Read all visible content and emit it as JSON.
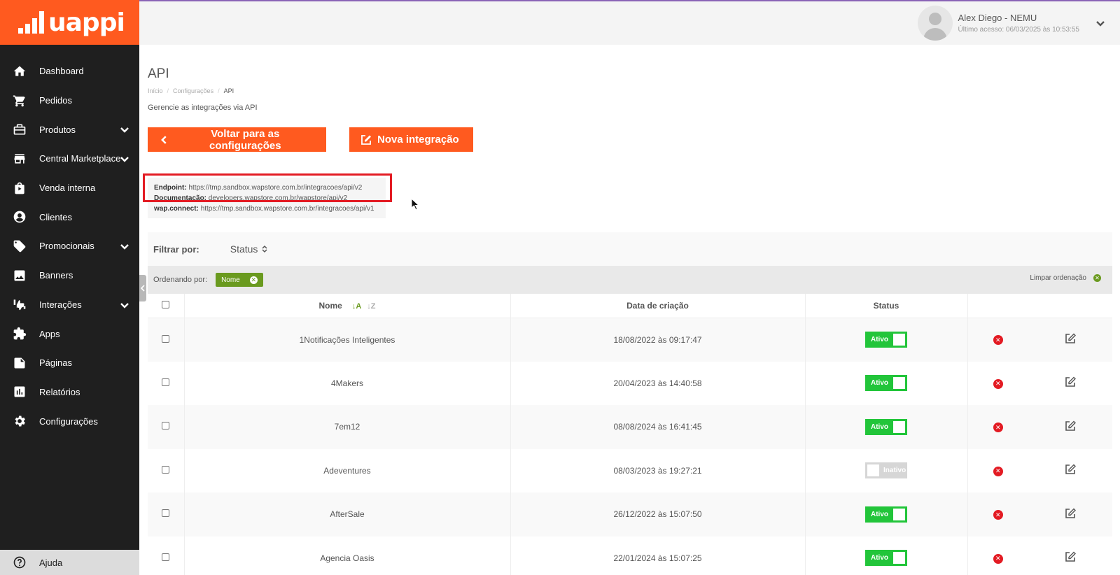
{
  "brand": {
    "name": "uappi"
  },
  "sidebar": {
    "items": [
      {
        "label": "Dashboard",
        "icon": "home-icon"
      },
      {
        "label": "Pedidos",
        "icon": "cart-icon"
      },
      {
        "label": "Produtos",
        "icon": "box-icon",
        "expandable": true
      },
      {
        "label": "Central Marketplace",
        "icon": "store-icon",
        "expandable": true
      },
      {
        "label": "Venda interna",
        "icon": "bag-icon"
      },
      {
        "label": "Clientes",
        "icon": "user-icon"
      },
      {
        "label": "Promocionais",
        "icon": "tag-icon",
        "expandable": true
      },
      {
        "label": "Banners",
        "icon": "image-icon"
      },
      {
        "label": "Interações",
        "icon": "thumbs-icon",
        "expandable": true
      },
      {
        "label": "Apps",
        "icon": "puzzle-icon"
      },
      {
        "label": "Páginas",
        "icon": "page-icon"
      },
      {
        "label": "Relatórios",
        "icon": "chart-icon"
      },
      {
        "label": "Configurações",
        "icon": "gear-icon"
      }
    ],
    "help_label": "Ajuda"
  },
  "header": {
    "user_name": "Alex Diego - NEMU",
    "last_access": "Último acesso: 06/03/2025 às 10:53:55"
  },
  "page": {
    "title": "API",
    "breadcrumb": [
      "Início",
      "Configurações",
      "API"
    ],
    "subtitle": "Gerencie as integrações via API"
  },
  "buttons": {
    "back": "Voltar para as configurações",
    "new": "Nova integração"
  },
  "api_info": {
    "endpoint_label": "Endpoint:",
    "endpoint_value": "https://tmp.sandbox.wapstore.com.br/integracoes/api/v2",
    "docs_label": "Documentação:",
    "docs_value": "developers.wapstore.com.br/wapstore/api/v2",
    "wapconnect_label": "wap.connect:",
    "wapconnect_value": "https://tmp.sandbox.wapstore.com.br/integracoes/api/v1"
  },
  "filter": {
    "label": "Filtrar por:",
    "status": "Status"
  },
  "ordering": {
    "label": "Ordenando por:",
    "chip": "Nome",
    "clear": "Limpar ordenação"
  },
  "table": {
    "headers": {
      "name": "Nome",
      "sort_a": "↓A",
      "sort_z": "↓Z",
      "created": "Data de criação",
      "status": "Status"
    },
    "rows": [
      {
        "name": "1Notificações Inteligentes",
        "created": "18/08/2022 às 09:17:47",
        "status": "Ativo",
        "active": true
      },
      {
        "name": "4Makers",
        "created": "20/04/2023 às 14:40:58",
        "status": "Ativo",
        "active": true
      },
      {
        "name": "7em12",
        "created": "08/08/2024 às 16:41:45",
        "status": "Ativo",
        "active": true
      },
      {
        "name": "Adeventures",
        "created": "08/03/2023 às 19:27:21",
        "status": "Inativo",
        "active": false
      },
      {
        "name": "AfterSale",
        "created": "26/12/2022 às 15:07:50",
        "status": "Ativo",
        "active": true
      },
      {
        "name": "Agencia Oasis",
        "created": "22/01/2024 às 15:07:25",
        "status": "Ativo",
        "active": true
      }
    ]
  },
  "colors": {
    "brand": "#ff5a1f",
    "sidebar": "#1f1f1f",
    "active": "#22c53a",
    "inactive": "#d6d6d6",
    "delete": "#e31b23",
    "highlight": "#e31b23",
    "chip": "#6a9a1f"
  }
}
